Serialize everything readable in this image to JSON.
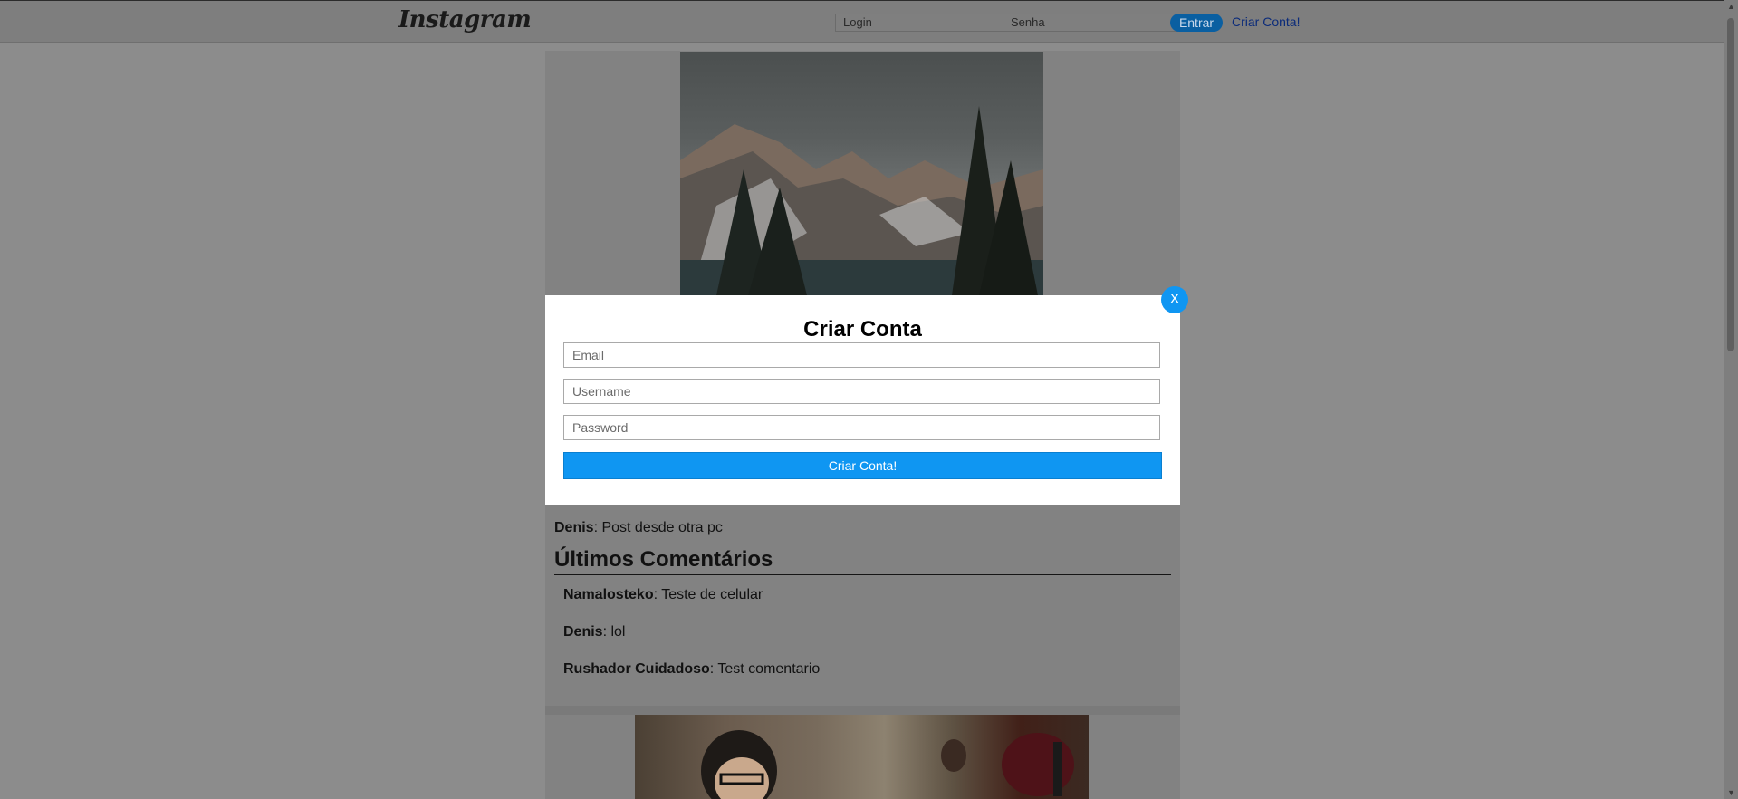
{
  "header": {
    "logo": "Instagram",
    "login_placeholder": "Login",
    "password_placeholder": "Senha",
    "enter_label": "Entrar",
    "create_account_link": "Criar Conta!"
  },
  "post1": {
    "caption_user": "Denis",
    "caption_text": ": Post desde otra pc",
    "comments_title": "Últimos Comentários",
    "comments": [
      {
        "user": "Namalosteko",
        "text": ": Teste de celular"
      },
      {
        "user": "Denis",
        "text": ": lol"
      },
      {
        "user": "Rushador Cuidadoso",
        "text": ": Test comentario"
      }
    ]
  },
  "modal": {
    "close_label": "X",
    "title": "Criar Conta",
    "email_placeholder": "Email",
    "username_placeholder": "Username",
    "password_placeholder": "Password",
    "submit_label": "Criar Conta!"
  },
  "colors": {
    "accent": "#0f96f2",
    "overlay_background": "#8c8c8c",
    "modal_background": "#ffffff"
  }
}
